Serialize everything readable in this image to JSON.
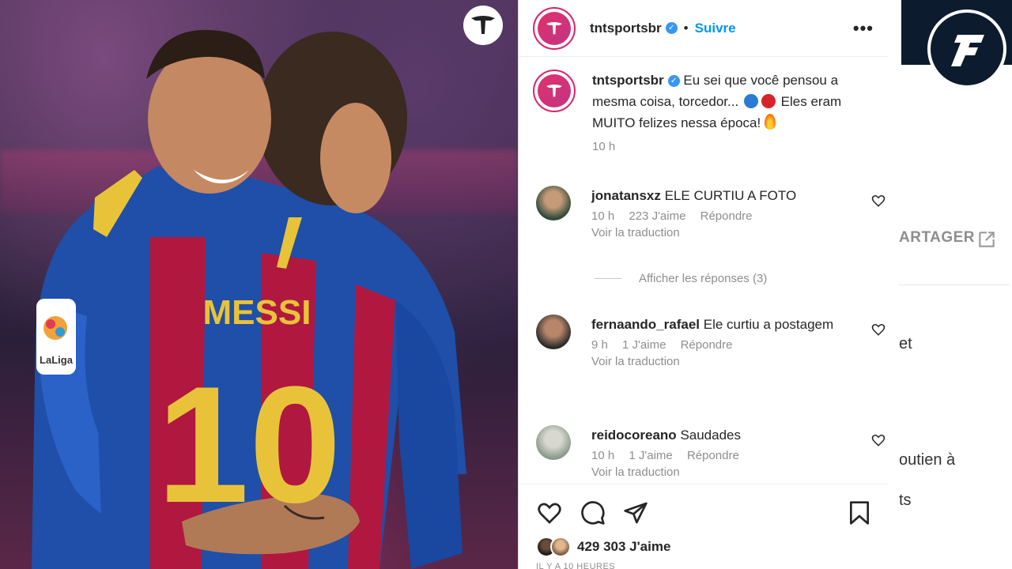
{
  "photo": {
    "jersey_name": "MESSI",
    "jersey_number": "10",
    "league_badge": "LaLiga",
    "watermark_logo": "tnt-logo"
  },
  "post": {
    "username": "tntsportsbr",
    "follow_label": "Suivre",
    "separator": "•",
    "more_label": "•••",
    "caption": {
      "username": "tntsportsbr",
      "text_part1": "Eu sei que você pensou a mesma coisa, torcedor...",
      "text_part2": "Eles eram MUITO felizes nessa época!",
      "time": "10 h"
    },
    "comments": [
      {
        "username": "jonatansxz",
        "text": "ELE CURTIU A FOTO",
        "time": "10 h",
        "likes": "223 J'aime",
        "reply": "Répondre",
        "translate": "Voir la traduction"
      },
      {
        "username": "fernaando_rafael",
        "text": "Ele curtiu a postagem",
        "time": "9 h",
        "likes": "1 J'aime",
        "reply": "Répondre",
        "translate": "Voir la traduction"
      },
      {
        "username": "reidocoreano",
        "text": "Saudades",
        "time": "10 h",
        "likes": "1 J'aime",
        "reply": "Répondre",
        "translate": "Voir la traduction"
      }
    ],
    "view_replies": "Afficher les réponses (3)",
    "likes_count": "429 303 J'aime",
    "time_ago": "IL Y A 10 HEURES"
  },
  "right_page": {
    "share_label": "ARTAGER",
    "text_1": "et",
    "text_2": "outien à",
    "text_3": "ts"
  },
  "colors": {
    "follow": "#0095f6",
    "verified": "#3897f0",
    "avatar_ring": "#d6246e",
    "barca_blue": "#1f4fa8",
    "barca_red": "#b01840",
    "jersey_gold": "#e8c33a"
  }
}
